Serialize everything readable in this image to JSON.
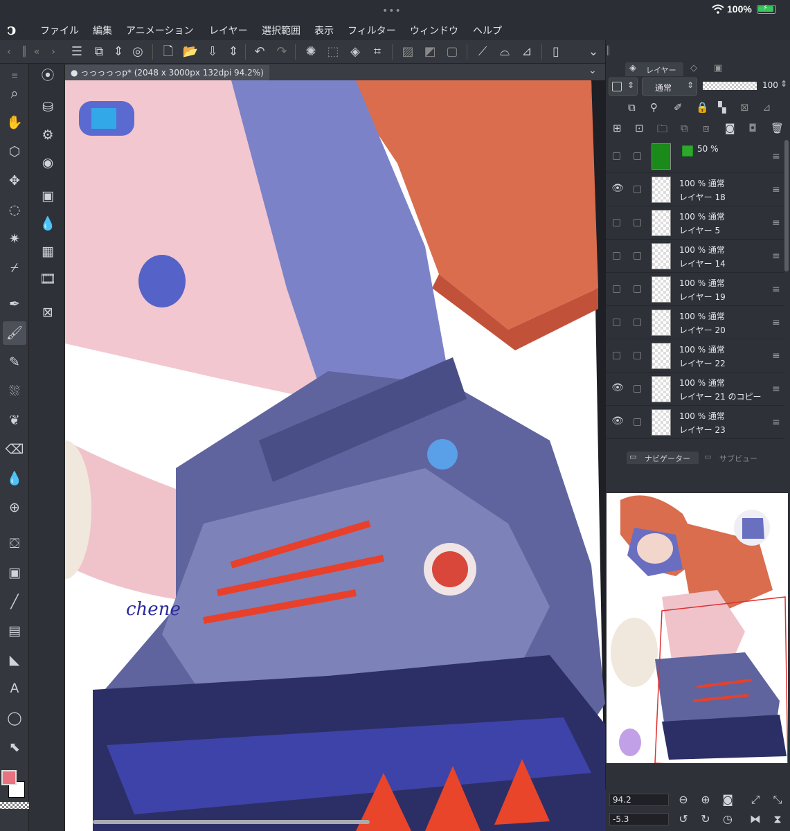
{
  "status_bar": {
    "battery_percent": "100%",
    "colors": {
      "battery": "#34c759"
    }
  },
  "menu": {
    "items": [
      "ファイル",
      "編集",
      "アニメーション",
      "レイヤー",
      "選択範囲",
      "表示",
      "フィルター",
      "ウィンドウ",
      "ヘルプ"
    ]
  },
  "document": {
    "tab_title": "っっっっっp* (2048 x 3000px 132dpi 94.2%)"
  },
  "left_tools": [
    "zoom-icon",
    "hand-icon",
    "camera-rotate-icon",
    "move-icon",
    "lasso-select-icon",
    "magic-wand-icon",
    "eyedropper-icon",
    "pen-icon",
    "brush-icon",
    "pencil-icon",
    "airbrush-icon",
    "decoration-icon",
    "eraser-icon",
    "blend-icon",
    "grid-icon",
    "fill-icon",
    "gradient-icon",
    "line-icon",
    "frame-icon",
    "ruler-icon",
    "text-icon",
    "balloon-icon",
    "correction-icon"
  ],
  "layer_panel": {
    "tab_label": "レイヤー",
    "blend_mode": "通常",
    "opacity": "100",
    "layers": [
      {
        "opacity_mode": "50 %",
        "name": "",
        "visible": false,
        "type": "color"
      },
      {
        "opacity_mode": "100 %  通常",
        "name": "レイヤー 18",
        "visible": true
      },
      {
        "opacity_mode": "100 %  通常",
        "name": "レイヤー 5",
        "visible": false
      },
      {
        "opacity_mode": "100 %  通常",
        "name": "レイヤー 14",
        "visible": false
      },
      {
        "opacity_mode": "100 %  通常",
        "name": "レイヤー 19",
        "visible": false
      },
      {
        "opacity_mode": "100 %  通常",
        "name": "レイヤー 20",
        "visible": false
      },
      {
        "opacity_mode": "100 %  通常",
        "name": "レイヤー 22",
        "visible": false
      },
      {
        "opacity_mode": "100 %  通常",
        "name": "レイヤー 21 のコピー",
        "visible": true
      },
      {
        "opacity_mode": "100 %  通常",
        "name": "レイヤー 23",
        "visible": true
      }
    ]
  },
  "navigator": {
    "tab_label": "ナビゲーター",
    "sub_tab_label": "サブビュー",
    "zoom": "94.2",
    "rotation": "-5.3"
  },
  "colors": {
    "main_color": "#e8737f",
    "sub_color": "#ffffff",
    "accent_layer": "#1a8a1a"
  }
}
